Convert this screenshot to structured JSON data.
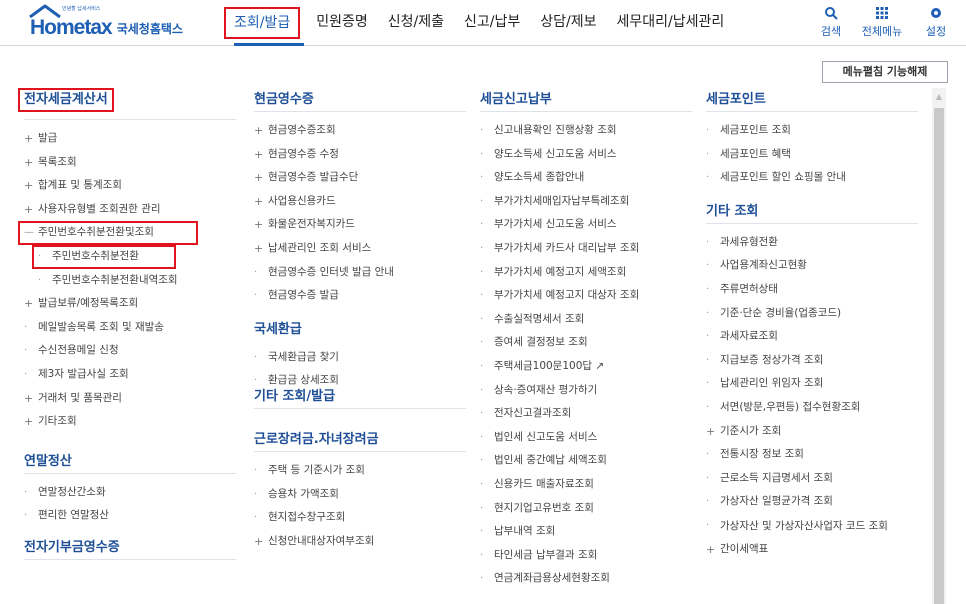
{
  "logo": {
    "brand_home": "Home",
    "brand_tax": "tax",
    "brand_sub": "안녕할 납세서비스",
    "brand_kr": "국세청홈택스"
  },
  "gnb": [
    "조회/발급",
    "민원증명",
    "신청/제출",
    "신고/납부",
    "상담/제보",
    "세무대리/납세관리"
  ],
  "util": {
    "search_label": "검색",
    "allmenu_label": "전체메뉴",
    "settings_label": "설정",
    "search_icon": "search-icon",
    "allmenu_icon": "grid-icon",
    "settings_icon": "gear-icon"
  },
  "menu_toggle_label": "메뉴펼침 기능해제",
  "colors": {
    "brand_blue": "#1e5fb4",
    "highlight_red": "#e0141f"
  },
  "col1": {
    "title": "전자세금계산서",
    "items": [
      {
        "label": "발급",
        "bullet": "plus"
      },
      {
        "label": "목록조회",
        "bullet": "plus"
      },
      {
        "label": "합계표 및 통계조회",
        "bullet": "plus"
      },
      {
        "label": "사용자유형별 조회권한 관리",
        "bullet": "plus"
      },
      {
        "label": "주민번호수취분전환및조회",
        "bullet": "minus",
        "box": true
      },
      {
        "label": "주민번호수취분전환",
        "bullet": "dot",
        "sub": true,
        "box": true
      },
      {
        "label": "주민번호수취분전환내역조회",
        "bullet": "dot",
        "sub": true
      },
      {
        "label": "발급보류/예정목록조회",
        "bullet": "plus"
      },
      {
        "label": "메일발송목록 조회 및 재발송",
        "bullet": "dot"
      },
      {
        "label": "수신전용메일 신청",
        "bullet": "dot"
      },
      {
        "label": "제3자 발급사실 조회",
        "bullet": "dot"
      },
      {
        "label": "거래처 및 품목관리",
        "bullet": "plus"
      },
      {
        "label": "기타조회",
        "bullet": "plus"
      }
    ],
    "title2": "연말정산",
    "items2": [
      {
        "label": "연말정산간소화",
        "bullet": "dot"
      },
      {
        "label": "편리한 연말정산",
        "bullet": "dot"
      }
    ],
    "title3": "전자기부금영수증"
  },
  "col2": {
    "title": "현금영수증",
    "items": [
      {
        "label": "현금영수증조회",
        "bullet": "plus"
      },
      {
        "label": "현금영수증 수정",
        "bullet": "plus"
      },
      {
        "label": "현금영수증 발급수단",
        "bullet": "plus"
      },
      {
        "label": "사업용신용카드",
        "bullet": "plus"
      },
      {
        "label": "화물운전자복지카드",
        "bullet": "plus"
      },
      {
        "label": "납세관리인 조회 서비스",
        "bullet": "plus"
      },
      {
        "label": "현금영수증 인터넷 발급 안내",
        "bullet": "dot"
      },
      {
        "label": "현금영수증 발급",
        "bullet": "dot"
      }
    ],
    "title2": "국세환급",
    "items2": [
      {
        "label": "국세환급금 찾기",
        "bullet": "dot"
      },
      {
        "label": "환급금 상세조회",
        "bullet": "dot"
      }
    ],
    "title3": "기타 조회/발급",
    "title4": "근로장려금.자녀장려금",
    "items4": [
      {
        "label": "주택 등 기준시가 조회",
        "bullet": "dot"
      },
      {
        "label": "승용차 가액조회",
        "bullet": "dot"
      },
      {
        "label": "현지접수창구조회",
        "bullet": "dot"
      },
      {
        "label": "신청안내대상자여부조회",
        "bullet": "plus"
      }
    ]
  },
  "col3": {
    "title": "세금신고납부",
    "items": [
      {
        "label": "신고내용확인 진행상황 조회",
        "bullet": "dot"
      },
      {
        "label": "양도소득세 신고도움 서비스",
        "bullet": "dot"
      },
      {
        "label": "양도소득세 종합안내",
        "bullet": "dot"
      },
      {
        "label": "부가가치세매입자납부특례조회",
        "bullet": "dot"
      },
      {
        "label": "부가가치세 신고도움 서비스",
        "bullet": "dot"
      },
      {
        "label": "부가가치세 카드사 대리납부 조회",
        "bullet": "dot"
      },
      {
        "label": "부가가치세 예정고지 세액조회",
        "bullet": "dot"
      },
      {
        "label": "부가가치세 예정고지 대상자 조회",
        "bullet": "dot"
      },
      {
        "label": "수출실적명세서 조회",
        "bullet": "dot"
      },
      {
        "label": "증여세 결정정보 조회",
        "bullet": "dot"
      },
      {
        "label": "주택세금100문100답 ↗",
        "bullet": "dot"
      },
      {
        "label": "상속·증여재산 평가하기",
        "bullet": "dot"
      },
      {
        "label": "전자신고결과조회",
        "bullet": "dot"
      },
      {
        "label": "법인세 신고도움 서비스",
        "bullet": "dot"
      },
      {
        "label": "법인세 중간예납 세액조회",
        "bullet": "dot"
      },
      {
        "label": "신용카드 매출자료조회",
        "bullet": "dot"
      },
      {
        "label": "현지기업고유번호 조회",
        "bullet": "dot"
      },
      {
        "label": "납부내역 조회",
        "bullet": "dot"
      },
      {
        "label": "타인세금 납부결과 조회",
        "bullet": "dot"
      },
      {
        "label": "연금계좌급용상세현황조회",
        "bullet": "dot"
      }
    ]
  },
  "col4": {
    "title": "세금포인트",
    "items": [
      {
        "label": "세금포인트 조회",
        "bullet": "dot"
      },
      {
        "label": "세금포인트 혜택",
        "bullet": "dot"
      },
      {
        "label": "세금포인트 할인 쇼핑몰 안내",
        "bullet": "dot"
      }
    ],
    "title2": "기타 조회",
    "items2": [
      {
        "label": "과세유형전환",
        "bullet": "dot"
      },
      {
        "label": "사업용계좌신고현황",
        "bullet": "dot"
      },
      {
        "label": "주류면허상태",
        "bullet": "dot"
      },
      {
        "label": "기준·단순 경비율(업종코드)",
        "bullet": "dot"
      },
      {
        "label": "과세자료조회",
        "bullet": "dot"
      },
      {
        "label": "지급보증 정상가격 조회",
        "bullet": "dot"
      },
      {
        "label": "납세관리인 위임자 조회",
        "bullet": "dot"
      },
      {
        "label": "서면(방문,우편등) 접수현황조회",
        "bullet": "dot"
      },
      {
        "label": "기준시가 조회",
        "bullet": "plus"
      },
      {
        "label": "전통시장 정보 조회",
        "bullet": "dot"
      },
      {
        "label": "근로소득 지급명세서 조회",
        "bullet": "dot"
      },
      {
        "label": "가상자산 일평균가격 조회",
        "bullet": "dot"
      },
      {
        "label": "가상자산 및 가상자산사업자 코드 조회",
        "bullet": "dot",
        "tall": true
      },
      {
        "label": "간이세액표",
        "bullet": "plus"
      }
    ]
  }
}
